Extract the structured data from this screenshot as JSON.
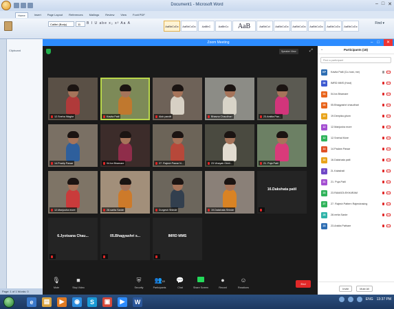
{
  "word": {
    "title": "Document1 - Microsoft Word",
    "tabs": [
      "Home",
      "Insert",
      "Page Layout",
      "References",
      "Mailings",
      "Review",
      "View",
      "Foxit PDF"
    ],
    "font": "Calibri (Body)",
    "font_size": "11",
    "format_row": "B I U abe x₂ x² Aa A",
    "style_samples": [
      "AaBbCcDc",
      "AaBbCcDc",
      "AaBbC",
      "AaBbCc",
      "AaB",
      "AaBbCcl",
      "AaBbCcDc",
      "AaBbCcDc",
      "AaBbCcDc",
      "AaBbCcDc",
      "AaBbCcDc"
    ],
    "find_label": "Find ▾",
    "clipboard_label": "Clipboard",
    "status": "Page: 1 of 1   Words: 0"
  },
  "zoom": {
    "title": "Zoom Meeting",
    "speaker_view": "Speaker View",
    "tiles": [
      {
        "name": "12.Sneha Waghe",
        "video": true,
        "shirt": "#b03a3a",
        "bg": "#5a5046"
      },
      {
        "name": "Kavita Patil",
        "video": true,
        "shirt": "#c0782e",
        "bg": "#7d8a58",
        "active": true
      },
      {
        "name": "Alok pandit",
        "video": true,
        "shirt": "#d7d0c4",
        "bg": "#6e6258"
      },
      {
        "name": "Bhavna Chaudhari",
        "video": true,
        "shirt": "#d8d4c8",
        "bg": "#8c8c86"
      },
      {
        "name": "23.Ankita Pan...",
        "video": true,
        "shirt": "#d2357b",
        "bg": "#5b5a52"
      },
      {
        "name": "14.Pradip Pawar",
        "video": true,
        "shirt": "#2e5f9c",
        "bg": "#7a7064"
      },
      {
        "name": "04.Ira Bhamare",
        "video": true,
        "shirt": "#8f2d4a",
        "bg": "#3c2c2a"
      },
      {
        "name": "27. Rajesh Pawar N...",
        "video": true,
        "shirt": "#b7483a",
        "bg": "#6c6458"
      },
      {
        "name": "23.Vinayak Okhil...",
        "video": true,
        "shirt": "#e2dcd0",
        "bg": "#4a4a40"
      },
      {
        "name": "21. Puja Patil",
        "video": true,
        "shirt": "#d93a7a",
        "bg": "#6c8064"
      },
      {
        "name": "12.Manjusha more",
        "video": true,
        "shirt": "#c93b3b",
        "bg": "#7e7466"
      },
      {
        "name": "28.sarita Sarde",
        "video": true,
        "shirt": "#cd7a2a",
        "bg": "#a28f7a"
      },
      {
        "name": "Durgesh Shinde",
        "video": true,
        "shirt": "#323f4e",
        "bg": "#6c665c"
      },
      {
        "name": "19.Dakshata Shinde",
        "video": true,
        "shirt": "#d98324",
        "bg": "#8a8078"
      },
      {
        "name": "16.Dakshata patil",
        "video": false
      },
      {
        "name": "6.Jyotsana Chau...",
        "video": false
      },
      {
        "name": "05.Bhagyashri s...",
        "video": false
      },
      {
        "name": "IMRD MMS",
        "video": false
      }
    ],
    "toolbar": {
      "mute": "Mute",
      "stop_video": "Stop Video",
      "security": "Security",
      "participants": "Participants",
      "participants_count": "18",
      "chat": "Chat",
      "share_screen": "Share Screen",
      "record": "Record",
      "reactions": "Reactions",
      "end": "End"
    },
    "participants_panel": {
      "title": "Participants (18)",
      "search_placeholder": "Find a participant",
      "invite": "Invite",
      "mute_all": "Mute All",
      "list": [
        {
          "initials": "KP",
          "name": "Kavita Patil (Co-host, me)",
          "color": "#2e6eb3",
          "mic": "on"
        },
        {
          "initials": "IM",
          "name": "IMRD MMS (Host)",
          "color": "#3d5ad1",
          "mic": "off"
        },
        {
          "initials": "04",
          "name": "04.Ira Bhamare",
          "color": "#e8641b",
          "mic": "off"
        },
        {
          "initials": "05",
          "name": "05.Bhagyashri chaudhari",
          "color": "#e8641b",
          "mic": "off"
        },
        {
          "initials": "19",
          "name": "19.Deepika ghorn",
          "color": "#e8a41b",
          "mic": "off"
        },
        {
          "initials": "12",
          "name": "12.Manjusha more",
          "color": "#a44fd1",
          "mic": "off"
        },
        {
          "initials": "12",
          "name": "12.Snehal More",
          "color": "#2fb35a",
          "mic": "off"
        },
        {
          "initials": "14",
          "name": "14.Padam Pawar",
          "color": "#e05226",
          "mic": "off"
        },
        {
          "initials": "16",
          "name": "16.Dakshata patil",
          "color": "#e8a41b",
          "mic": "off"
        },
        {
          "initials": "2",
          "name": "2L.Kalashali",
          "color": "#7048c6",
          "mic": "off"
        },
        {
          "initials": "21",
          "name": "21. Puja Patil",
          "color": "#a44fd1",
          "mic": "off"
        },
        {
          "initials": "23",
          "name": "23.RAMATA EKHARAM",
          "color": "#2fb35a",
          "mic": "off"
        },
        {
          "initials": "27",
          "name": "27. Rajesh Pattern Rajendrasing",
          "color": "#2fb35a",
          "mic": "off"
        },
        {
          "initials": "28",
          "name": "28.rerita Sarde",
          "color": "#2eb3a8",
          "mic": "off"
        },
        {
          "initials": "23",
          "name": "23.Ankita Pathare",
          "color": "#2e6eb3",
          "mic": "off"
        }
      ]
    }
  },
  "taskbar": {
    "language": "ENG",
    "time": "13:37 PM"
  }
}
